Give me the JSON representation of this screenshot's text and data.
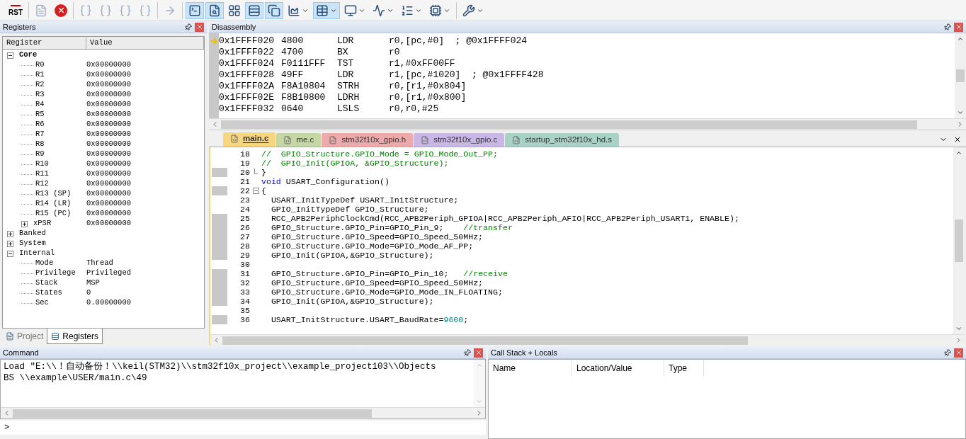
{
  "toolbar": {
    "groups": [
      [
        {
          "label": "RST",
          "pressed": false,
          "disabled": false,
          "dropdown": false
        }
      ],
      [
        {
          "pressed": false,
          "disabled": true,
          "dropdown": false
        },
        {
          "pressed": false,
          "disabled": false,
          "dropdown": false
        }
      ],
      [
        {
          "pressed": false,
          "disabled": true,
          "dropdown": false
        },
        {
          "pressed": false,
          "disabled": true,
          "dropdown": false
        },
        {
          "pressed": false,
          "disabled": true,
          "dropdown": false
        },
        {
          "pressed": false,
          "disabled": true,
          "dropdown": false
        }
      ],
      [
        {
          "pressed": false,
          "disabled": true,
          "dropdown": false
        }
      ],
      [
        {
          "pressed": true,
          "disabled": false,
          "dropdown": false
        },
        {
          "pressed": true,
          "disabled": false,
          "dropdown": false
        },
        {
          "pressed": false,
          "disabled": false,
          "dropdown": false
        },
        {
          "pressed": true,
          "disabled": false,
          "dropdown": false
        },
        {
          "pressed": true,
          "disabled": false,
          "dropdown": false
        },
        {
          "pressed": false,
          "disabled": false,
          "dropdown": true
        },
        {
          "pressed": true,
          "disabled": false,
          "dropdown": true
        },
        {
          "pressed": false,
          "disabled": false,
          "dropdown": true
        },
        {
          "pressed": false,
          "disabled": false,
          "dropdown": true
        },
        {
          "pressed": false,
          "disabled": false,
          "dropdown": true
        },
        {
          "pressed": false,
          "disabled": false,
          "dropdown": true
        }
      ],
      [
        {
          "pressed": false,
          "disabled": false,
          "dropdown": true
        }
      ]
    ]
  },
  "registers": {
    "title": "Registers",
    "columns": [
      "Register",
      "Value"
    ],
    "tree": [
      {
        "name": "Core",
        "emphasized": true,
        "expanded": true,
        "children": [
          {
            "name": "R0",
            "value": "0x00000000"
          },
          {
            "name": "R1",
            "value": "0x00000000"
          },
          {
            "name": "R2",
            "value": "0x00000000"
          },
          {
            "name": "R3",
            "value": "0x00000000"
          },
          {
            "name": "R4",
            "value": "0x00000000"
          },
          {
            "name": "R5",
            "value": "0x00000000"
          },
          {
            "name": "R6",
            "value": "0x00000000"
          },
          {
            "name": "R7",
            "value": "0x00000000"
          },
          {
            "name": "R8",
            "value": "0x00000000"
          },
          {
            "name": "R9",
            "value": "0x00000000"
          },
          {
            "name": "R10",
            "value": "0x00000000"
          },
          {
            "name": "R11",
            "value": "0x00000000"
          },
          {
            "name": "R12",
            "value": "0x00000000"
          },
          {
            "name": "R13 (SP)",
            "value": "0x00000000"
          },
          {
            "name": "R14 (LR)",
            "value": "0x00000000"
          },
          {
            "name": "R15 (PC)",
            "value": "0x00000000"
          },
          {
            "name": "xPSR",
            "value": "0x00000000",
            "expanded": false
          }
        ]
      },
      {
        "name": "Banked",
        "emphasized": false,
        "expanded": false
      },
      {
        "name": "System",
        "emphasized": false,
        "expanded": false
      },
      {
        "name": "Internal",
        "emphasized": false,
        "expanded": true,
        "children": [
          {
            "name": "Mode",
            "value": "Thread"
          },
          {
            "name": "Privilege",
            "value": "Privileged"
          },
          {
            "name": "Stack",
            "value": "MSP"
          },
          {
            "name": "States",
            "value": "0"
          },
          {
            "name": "Sec",
            "value": "0.00000000"
          }
        ]
      }
    ],
    "tabs": [
      {
        "label": "Project",
        "selected": false
      },
      {
        "label": "Registers",
        "selected": true
      }
    ]
  },
  "disassembly": {
    "title": "Disassembly",
    "rows": [
      {
        "address": "0x1FFFF020",
        "opcode": "4800",
        "mnemonic": "LDR",
        "operands": "r0,[pc,#0]  ; @0x1FFFF024",
        "current": true
      },
      {
        "address": "0x1FFFF022",
        "opcode": "4700",
        "mnemonic": "BX",
        "operands": "r0",
        "current": false
      },
      {
        "address": "0x1FFFF024",
        "opcode": "F0111FFF",
        "mnemonic": "TST",
        "operands": "r1,#0xFF00FF",
        "current": false
      },
      {
        "address": "0x1FFFF028",
        "opcode": "49FF",
        "mnemonic": "LDR",
        "operands": "r1,[pc,#1020]  ; @0x1FFFF428",
        "current": false
      },
      {
        "address": "0x1FFFF02A",
        "opcode": "F8A10804",
        "mnemonic": "STRH",
        "operands": "r0,[r1,#0x804]",
        "current": false
      },
      {
        "address": "0x1FFFF02E",
        "opcode": "F8B10800",
        "mnemonic": "LDRH",
        "operands": "r0,[r1,#0x800]",
        "current": false
      },
      {
        "address": "0x1FFFF032",
        "opcode": "0640",
        "mnemonic": "LSLS",
        "operands": "r0,r0,#25",
        "current": false
      }
    ]
  },
  "editor": {
    "tabs": [
      {
        "label": "main.c",
        "selected": true,
        "color": "#f6d77f"
      },
      {
        "label": "me.c",
        "selected": false,
        "color": "#c5d7a5"
      },
      {
        "label": "stm32f10x_gpio.h",
        "selected": false,
        "color": "#eeaaaa"
      },
      {
        "label": "stm32f10x_gpio.c",
        "selected": false,
        "color": "#c9b7e6"
      },
      {
        "label": "startup_stm32f10x_hd.s",
        "selected": false,
        "color": "#a9d2c7"
      }
    ],
    "lines": [
      {
        "number": "18",
        "executable": false,
        "segments": [
          {
            "kind": "comment",
            "text": "//  GPIO_Structure.GPIO_Mode = GPIO_Mode_Out_PP;"
          }
        ]
      },
      {
        "number": "19",
        "executable": false,
        "segments": [
          {
            "kind": "comment",
            "text": "//  GPIO_Init(GPIOA, &GPIO_Structure);"
          }
        ]
      },
      {
        "number": "20",
        "executable": true,
        "fold_end": true,
        "segments": [
          {
            "kind": "code",
            "text": "}"
          }
        ]
      },
      {
        "number": "21",
        "executable": false,
        "segments": [
          {
            "kind": "keyword",
            "text": "void"
          },
          {
            "kind": "code",
            "text": " USART_Configuration()"
          }
        ]
      },
      {
        "number": "22",
        "executable": true,
        "fold_open": true,
        "segments": [
          {
            "kind": "code",
            "text": "{"
          }
        ]
      },
      {
        "number": "23",
        "executable": false,
        "segments": [
          {
            "kind": "code",
            "text": "  USART_InitTypeDef USART_InitStructure;"
          }
        ]
      },
      {
        "number": "24",
        "executable": false,
        "segments": [
          {
            "kind": "code",
            "text": "  GPIO_InitTypeDef GPIO_Structure;"
          }
        ]
      },
      {
        "number": "25",
        "executable": true,
        "segments": [
          {
            "kind": "code",
            "text": "  RCC_APB2PeriphClockCmd(RCC_APB2Periph_GPIOA|RCC_APB2Periph_AFIO|RCC_APB2Periph_USART1, ENABLE);"
          }
        ]
      },
      {
        "number": "26",
        "executable": true,
        "segments": [
          {
            "kind": "code",
            "text": "  GPIO_Structure.GPIO_Pin=GPIO_Pin_9;    "
          },
          {
            "kind": "comment",
            "text": "//transfer"
          }
        ]
      },
      {
        "number": "27",
        "executable": true,
        "segments": [
          {
            "kind": "code",
            "text": "  GPIO_Structure.GPIO_Speed=GPIO_Speed_50MHz;"
          }
        ]
      },
      {
        "number": "28",
        "executable": true,
        "segments": [
          {
            "kind": "code",
            "text": "  GPIO_Structure.GPIO_Mode=GPIO_Mode_AF_PP;"
          }
        ]
      },
      {
        "number": "29",
        "executable": true,
        "segments": [
          {
            "kind": "code",
            "text": "  GPIO_Init(GPIOA,&GPIO_Structure);"
          }
        ]
      },
      {
        "number": "30",
        "executable": false
      },
      {
        "number": "31",
        "executable": true,
        "segments": [
          {
            "kind": "code",
            "text": "  GPIO_Structure.GPIO_Pin=GPIO_Pin_10;   "
          },
          {
            "kind": "comment",
            "text": "//receive"
          }
        ]
      },
      {
        "number": "32",
        "executable": true,
        "segments": [
          {
            "kind": "code",
            "text": "  GPIO_Structure.GPIO_Speed=GPIO_Speed_50MHz;"
          }
        ]
      },
      {
        "number": "33",
        "executable": true,
        "segments": [
          {
            "kind": "code",
            "text": "  GPIO_Structure.GPIO_Mode=GPIO_Mode_IN_FLOATING;"
          }
        ]
      },
      {
        "number": "34",
        "executable": true,
        "segments": [
          {
            "kind": "code",
            "text": "  GPIO_Init(GPIOA,&GPIO_Structure);"
          }
        ]
      },
      {
        "number": "35",
        "executable": false
      },
      {
        "number": "36",
        "executable": true,
        "segments": [
          {
            "kind": "code",
            "text": "  USART_InitStructure.USART_BaudRate="
          },
          {
            "kind": "number",
            "text": "9600"
          },
          {
            "kind": "code",
            "text": ";"
          }
        ]
      }
    ]
  },
  "command": {
    "title": "Command",
    "output": [
      "Load \"E:\\\\！自动备份！\\\\keil(STM32)\\\\stm32f10x_project\\\\example_project103\\\\Objects",
      "BS \\\\example\\USER/main.c\\49"
    ],
    "prompt": ">"
  },
  "call_stack": {
    "title": "Call Stack + Locals",
    "columns": [
      "Name",
      "Location/Value",
      "Type"
    ]
  }
}
